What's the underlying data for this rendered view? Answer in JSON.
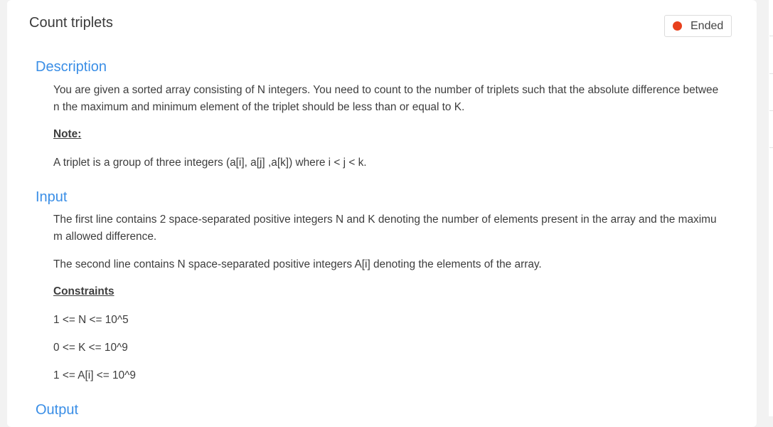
{
  "problem": {
    "title": "Count triplets",
    "status": "Ended",
    "status_color": "#e8401c"
  },
  "description": {
    "heading": "Description",
    "text": "You are given a sorted array consisting of N integers. You need to count to the number of triplets such that the absolute difference between the maximum and minimum element of the triplet should be less than or equal to K.",
    "note_heading": "Note:",
    "note_text": "A triplet is a group of three integers (a[i], a[j] ,a[k]) where i < j < k."
  },
  "input": {
    "heading": "Input",
    "line1": "The first line contains 2 space-separated positive integers N and K denoting the number of elements present in the array and the maximum allowed difference.",
    "line2": "The second line contains N space-separated positive integers A[i] denoting the elements of the array.",
    "constraints_heading": "Constraints",
    "constraints": [
      "1 <= N <= 10^5",
      "0 <= K <= 10^9",
      "1 <= A[i] <= 10^9"
    ]
  },
  "output": {
    "heading": "Output"
  },
  "colors": {
    "heading_blue": "#3a8ee6",
    "text": "#3d3d3d",
    "background": "#f2f2f2"
  }
}
